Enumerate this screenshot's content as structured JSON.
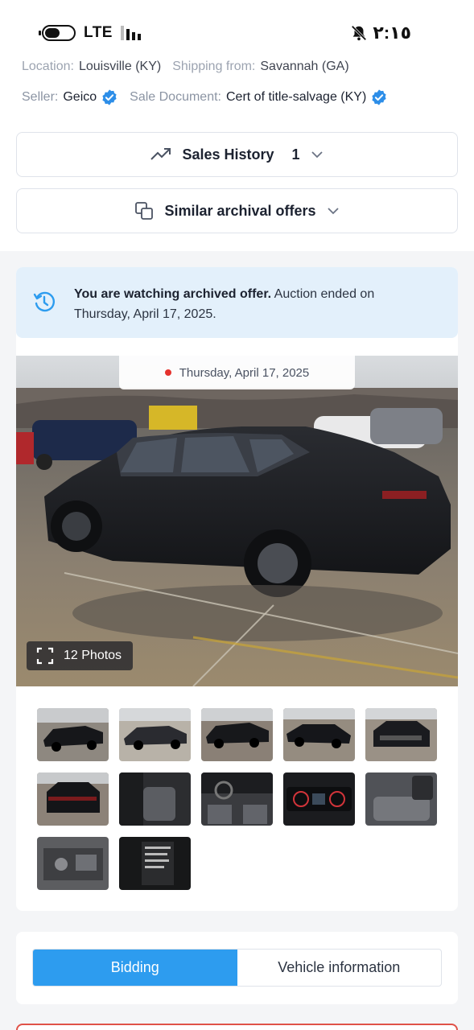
{
  "status_bar": {
    "network": "LTE",
    "time": "٢:١٥",
    "icons": [
      "battery-icon",
      "signal-icon",
      "bell-off-icon"
    ]
  },
  "vehicle_info": {
    "location_label": "Location:",
    "location_value": "Louisville (KY)",
    "shipping_label": "Shipping from:",
    "shipping_value": "Savannah (GA)",
    "seller_label": "Seller:",
    "seller_value": "Geico",
    "sale_doc_label": "Sale Document:",
    "sale_doc_value": "Cert of title-salvage (KY)"
  },
  "accordions": {
    "sales_history": {
      "label": "Sales History",
      "count": "1"
    },
    "similar_offers": {
      "label": "Similar archival offers"
    }
  },
  "notice": {
    "bold": "You are watching archived offer.",
    "text": " Auction ended on Thursday, April 17, 2025."
  },
  "gallery": {
    "date": "Thursday, April 17, 2025",
    "photos_count": "12 Photos",
    "thumbnails": [
      {
        "name": "thumb-1",
        "kind": "exterior-front-left"
      },
      {
        "name": "thumb-2",
        "kind": "exterior-side"
      },
      {
        "name": "thumb-3",
        "kind": "exterior-rear-right"
      },
      {
        "name": "thumb-4",
        "kind": "exterior-front-right"
      },
      {
        "name": "thumb-5",
        "kind": "exterior-front"
      },
      {
        "name": "thumb-6",
        "kind": "exterior-rear"
      },
      {
        "name": "thumb-7",
        "kind": "interior-front"
      },
      {
        "name": "thumb-8",
        "kind": "dashboard"
      },
      {
        "name": "thumb-9",
        "kind": "instrument-cluster"
      },
      {
        "name": "thumb-10",
        "kind": "rear-seats"
      },
      {
        "name": "thumb-11",
        "kind": "engine-bay"
      },
      {
        "name": "thumb-12",
        "kind": "vin-label"
      }
    ]
  },
  "tabs": {
    "bidding": "Bidding",
    "vehicle_information": "Vehicle information",
    "active": "bidding"
  },
  "colors": {
    "accent": "#2d9cef",
    "notice_bg": "#e3f0fb",
    "verified": "#2d8ee8",
    "status_dot": "#e5322d"
  }
}
